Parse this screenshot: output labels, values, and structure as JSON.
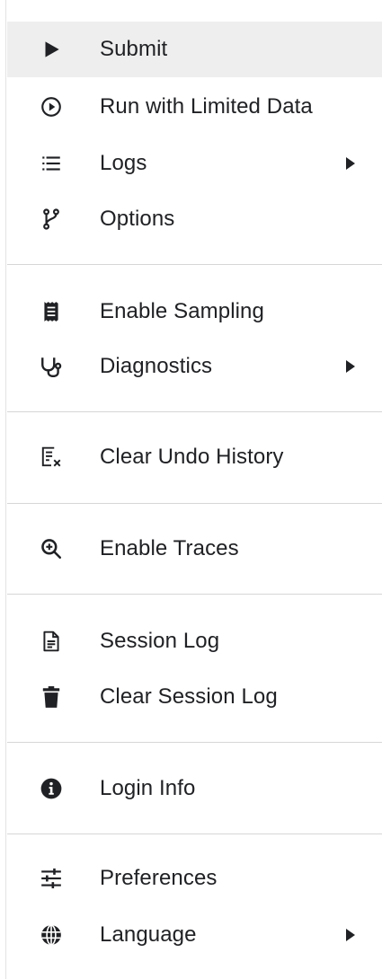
{
  "menu": {
    "items": [
      {
        "label": "Submit",
        "icon": "play-icon",
        "hover": true
      },
      {
        "label": "Run with Limited Data",
        "icon": "play-circle-icon"
      },
      {
        "label": "Logs",
        "icon": "list-icon",
        "submenu": true
      },
      {
        "label": "Options",
        "icon": "branch-icon"
      },
      {
        "label": "Enable Sampling",
        "icon": "receipt-icon"
      },
      {
        "label": "Diagnostics",
        "icon": "stethoscope-icon",
        "submenu": true
      },
      {
        "label": "Clear Undo History",
        "icon": "clear-list-icon"
      },
      {
        "label": "Enable Traces",
        "icon": "zoom-in-icon"
      },
      {
        "label": "Session Log",
        "icon": "document-icon"
      },
      {
        "label": "Clear Session Log",
        "icon": "trash-icon"
      },
      {
        "label": "Login Info",
        "icon": "info-icon"
      },
      {
        "label": "Preferences",
        "icon": "sliders-icon"
      },
      {
        "label": "Language",
        "icon": "globe-icon",
        "submenu": true
      }
    ]
  },
  "colors": {
    "text": "#202124",
    "icon": "#202124",
    "hover_background": "#eeeeee",
    "divider": "#d6d6d6"
  }
}
